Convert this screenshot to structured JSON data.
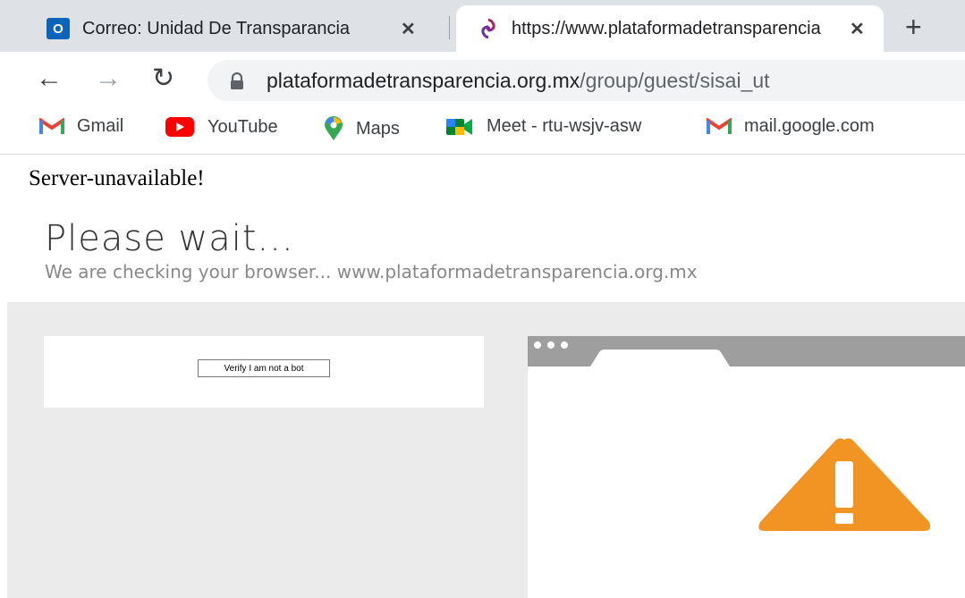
{
  "browser": {
    "tabs": [
      {
        "title": "Correo: Unidad De Transparancia"
      },
      {
        "title": "https://www.plataformadetransparencia"
      }
    ],
    "new_tab_label": "+",
    "url_host": "plataformadetransparencia.org.mx",
    "url_path": "/group/guest/sisai_ut",
    "bookmarks": [
      {
        "label": "Gmail",
        "icon": "gmail-icon"
      },
      {
        "label": "YouTube",
        "icon": "youtube-icon"
      },
      {
        "label": "Maps",
        "icon": "maps-icon"
      },
      {
        "label": "Meet - rtu-wsjv-asw",
        "icon": "meet-icon"
      },
      {
        "label": "mail.google.com",
        "icon": "gmail-icon"
      }
    ]
  },
  "page": {
    "server_message": "Server-unavailable!",
    "heading": "Please wait...",
    "subheading": "We are checking your browser... www.plataformadetransparencia.org.mx",
    "verify_button": "Verify I am not a bot"
  },
  "colors": {
    "warning": "#f29423",
    "tabstrip": "#dee1e6"
  }
}
